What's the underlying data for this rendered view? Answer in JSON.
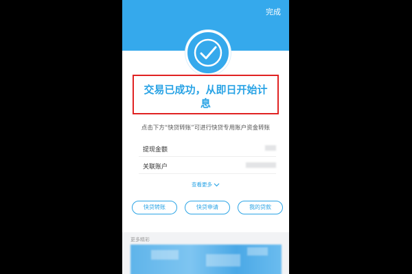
{
  "header": {
    "done_label": "完成",
    "bg_color": "#35a9ec"
  },
  "status": {
    "icon": "checkmark-circle-icon",
    "title_line1": "交易已成功，从即日开始计",
    "title_line2": "息",
    "highlight_color": "#e02020"
  },
  "tip": "点击下方“快贷转账”可进行快贷专用账户资金转账",
  "details": [
    {
      "label": "提现金额"
    },
    {
      "label": "关联账户"
    }
  ],
  "more_link": "查看更多",
  "actions": [
    {
      "label": "快贷转账"
    },
    {
      "label": "快贷申请"
    },
    {
      "label": "我的贷款"
    }
  ],
  "section_label": "更多精彩",
  "accent_color": "#29a3e5"
}
